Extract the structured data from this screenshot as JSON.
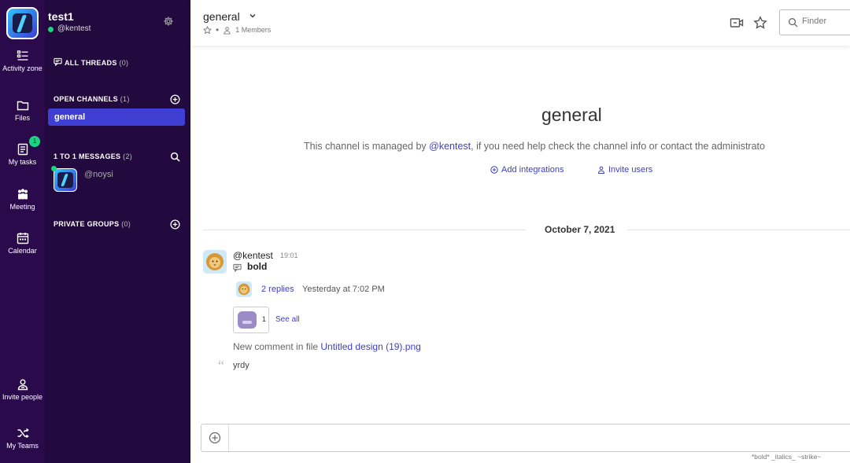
{
  "colors": {
    "rail_bg": "#2a0a4a",
    "sidebar_bg": "#220a3e",
    "active_channel": "#3f3fd3",
    "link": "#3e3ec9",
    "online": "#1cd37f"
  },
  "rail": {
    "items": [
      {
        "icon": "activity-icon",
        "label": "Activity zone"
      },
      {
        "icon": "files-icon",
        "label": "Files"
      },
      {
        "icon": "tasks-icon",
        "label": "My tasks",
        "badge": "1"
      },
      {
        "icon": "meeting-icon",
        "label": "Meeting"
      },
      {
        "icon": "calendar-icon",
        "label": "Calendar"
      },
      {
        "icon": "invite-people-icon",
        "label": "Invite people"
      },
      {
        "icon": "shuffle-icon",
        "label": "My Teams"
      }
    ]
  },
  "sidebar": {
    "workspace": "test1",
    "user": "@kentest",
    "all_threads": {
      "label": "ALL THREADS",
      "count": "(0)"
    },
    "open_channels": {
      "label": "OPEN CHANNELS",
      "count": "(1)",
      "items": [
        "general"
      ]
    },
    "direct_messages": {
      "label": "1 TO 1 MESSAGES",
      "count": "(2)",
      "items": [
        "@noysi"
      ]
    },
    "private_groups": {
      "label": "PRIVATE GROUPS",
      "count": "(0)"
    }
  },
  "header": {
    "channel": "general",
    "members": "1 Members",
    "finder_placeholder": "Finder"
  },
  "intro": {
    "title": "general",
    "text_prefix": "This channel is managed by ",
    "mention": "@kentest",
    "text_suffix": ", if you need help check the channel info or contact the administrato",
    "add_integrations": "Add integrations",
    "invite_users": "Invite users"
  },
  "messages": {
    "date": "October 7, 2021",
    "author": "@kentest",
    "time": "19:01",
    "text": "bold",
    "replies": "2 replies",
    "replies_time": "Yesterday at 7:02 PM",
    "attachment_count": "1",
    "see_all": "See all",
    "comment_prefix": "New comment in file ",
    "comment_file": "Untitled design (19).png",
    "quote": "yrdy"
  },
  "composer": {
    "format_hint": "*bold*  _italics_  ~strike~"
  }
}
